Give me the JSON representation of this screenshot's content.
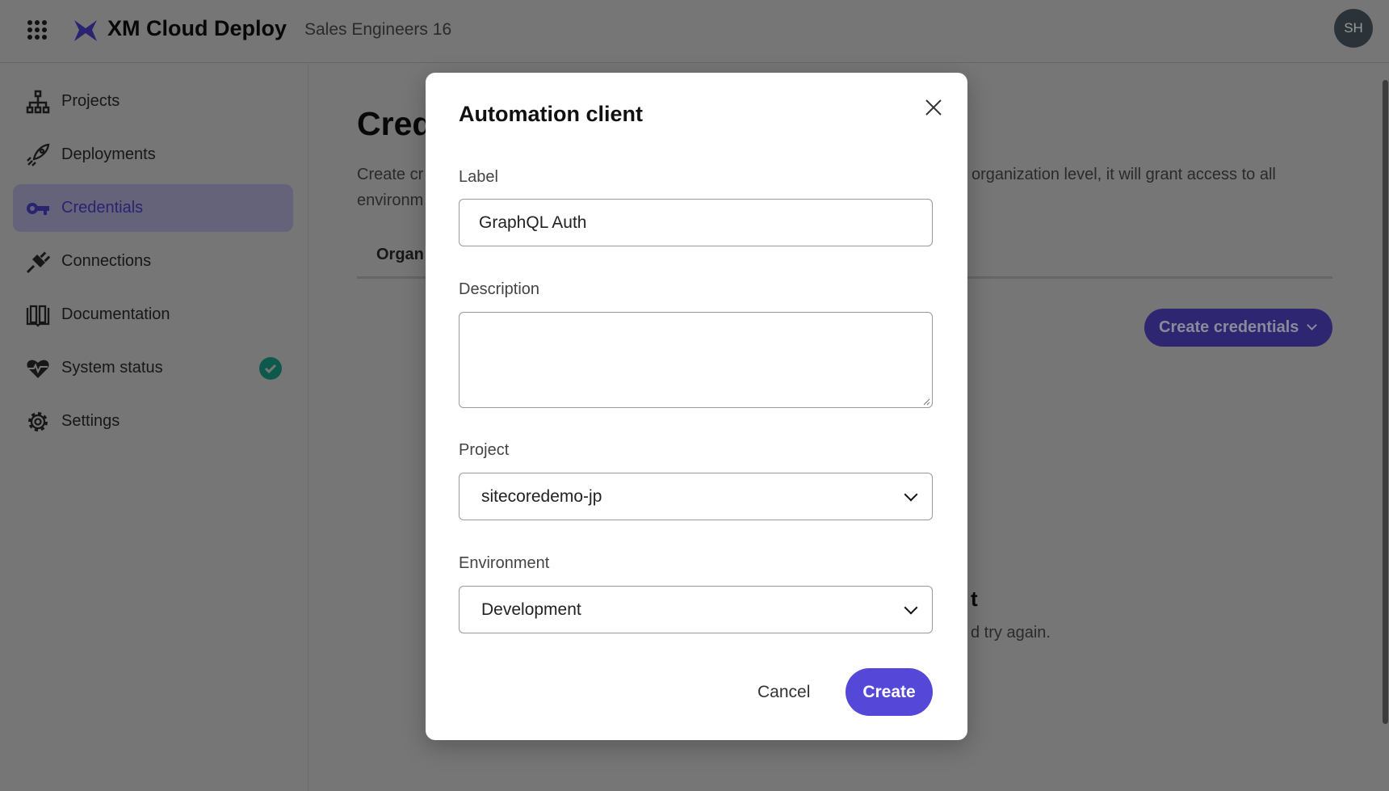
{
  "header": {
    "app_title": "XM Cloud Deploy",
    "org_name": "Sales Engineers 16",
    "avatar_initials": "SH",
    "icons": [
      "apps-grid-icon",
      "xm-cloud-logo-icon"
    ]
  },
  "sidebar": {
    "items": [
      {
        "label": "Projects",
        "icon": "sitemap-icon"
      },
      {
        "label": "Deployments",
        "icon": "rocket-icon"
      },
      {
        "label": "Credentials",
        "icon": "key-icon",
        "active": true
      },
      {
        "label": "Connections",
        "icon": "plug-icon"
      },
      {
        "label": "Documentation",
        "icon": "book-icon"
      },
      {
        "label": "System status",
        "icon": "heartbeat-icon",
        "status": "check-circle-icon"
      },
      {
        "label": "Settings",
        "icon": "gear-icon"
      }
    ]
  },
  "page": {
    "title_fragment": "Cred",
    "desc_fragment_1": "Create cr",
    "desc_fragment_2": "environm",
    "desc_fragment_right": "organization level, it will grant access to all",
    "tab_fragment": "Organ",
    "create_credentials_label": "Create credentials",
    "empty_title_fragment": "t",
    "empty_desc_fragment": "d try again."
  },
  "modal": {
    "title": "Automation client",
    "label_label": "Label",
    "label_value": "GraphQL Auth",
    "description_label": "Description",
    "description_value": "",
    "project_label": "Project",
    "project_value": "sitecoredemo-jp",
    "environment_label": "Environment",
    "environment_value": "Development",
    "cancel_label": "Cancel",
    "create_label": "Create"
  },
  "colors": {
    "accent": "#5548d9",
    "active_nav_bg": "#ececfb",
    "status_ok": "#1d9c86"
  }
}
